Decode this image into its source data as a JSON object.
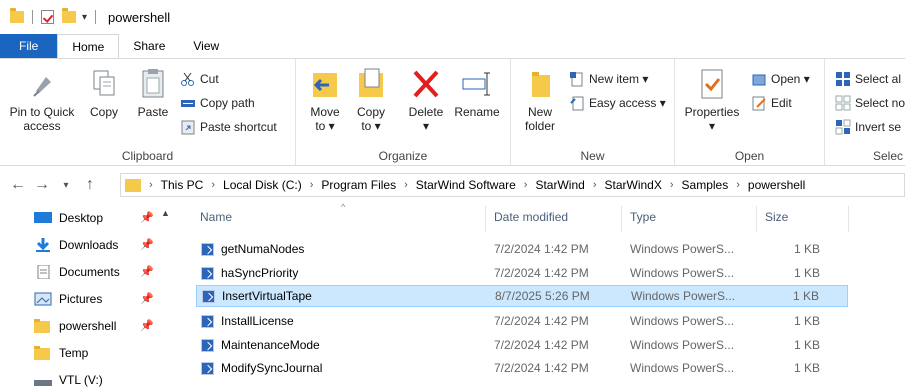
{
  "window": {
    "title": "powershell"
  },
  "tabs": [
    {
      "label": "File"
    },
    {
      "label": "Home"
    },
    {
      "label": "Share"
    },
    {
      "label": "View"
    }
  ],
  "ribbon": {
    "clipboard": {
      "label": "Clipboard",
      "pin_quick": [
        "Pin to Quick",
        "access"
      ],
      "copy": "Copy",
      "paste": "Paste",
      "cut": "Cut",
      "copy_path": "Copy path",
      "paste_shortcut": "Paste shortcut"
    },
    "organize": {
      "label": "Organize",
      "move_to": [
        "Move",
        "to ▾"
      ],
      "copy_to": [
        "Copy",
        "to ▾"
      ],
      "delete": [
        "Delete",
        "▾"
      ],
      "rename": "Rename"
    },
    "new": {
      "label": "New",
      "new_folder": [
        "New",
        "folder"
      ],
      "new_item": "New item ▾",
      "easy_access": "Easy access ▾"
    },
    "open": {
      "label": "Open",
      "properties": [
        "Properties",
        "▾"
      ],
      "open": "Open ▾",
      "edit": "Edit"
    },
    "select": {
      "label": "Selec",
      "select_all": "Select al",
      "select_none": "Select no",
      "invert": "Invert se"
    }
  },
  "breadcrumb": [
    "This PC",
    "Local Disk (C:)",
    "Program Files",
    "StarWind Software",
    "StarWind",
    "StarWindX",
    "Samples",
    "powershell"
  ],
  "navpane": [
    {
      "label": "Desktop",
      "icon": "desktop-icon",
      "pinned": true
    },
    {
      "label": "Downloads",
      "icon": "downloads-icon",
      "pinned": true
    },
    {
      "label": "Documents",
      "icon": "documents-icon",
      "pinned": true
    },
    {
      "label": "Pictures",
      "icon": "pictures-icon",
      "pinned": true
    },
    {
      "label": "powershell",
      "icon": "folder-icon",
      "pinned": true
    },
    {
      "label": "Temp",
      "icon": "folder-icon",
      "pinned": false
    },
    {
      "label": "VTL (V:)",
      "icon": "drive-icon",
      "pinned": false
    }
  ],
  "columns": {
    "name": "Name",
    "date": "Date modified",
    "type": "Type",
    "size": "Size"
  },
  "files": [
    {
      "name": "getNumaNodes",
      "date": "7/2/2024 1:42 PM",
      "type": "Windows PowerS...",
      "size": "1 KB",
      "selected": false
    },
    {
      "name": "haSyncPriority",
      "date": "7/2/2024 1:42 PM",
      "type": "Windows PowerS...",
      "size": "1 KB",
      "selected": false
    },
    {
      "name": "InsertVirtualTape",
      "date": "8/7/2025 5:26 PM",
      "type": "Windows PowerS...",
      "size": "1 KB",
      "selected": true
    },
    {
      "name": "InstallLicense",
      "date": "7/2/2024 1:42 PM",
      "type": "Windows PowerS...",
      "size": "1 KB",
      "selected": false
    },
    {
      "name": "MaintenanceMode",
      "date": "7/2/2024 1:42 PM",
      "type": "Windows PowerS...",
      "size": "1 KB",
      "selected": false
    },
    {
      "name": "ModifySyncJournal",
      "date": "7/2/2024 1:42 PM",
      "type": "Windows PowerS...",
      "size": "1 KB",
      "selected": false
    }
  ],
  "colors": {
    "accent": "#1a65c0",
    "selection": "#cce8ff",
    "folder": "#f6c94a"
  }
}
